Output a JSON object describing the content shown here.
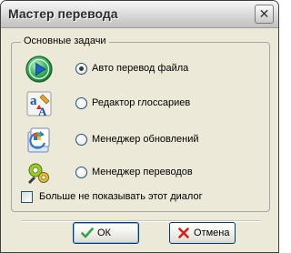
{
  "window": {
    "title": "Мастер перевода",
    "close_glyph": "✕"
  },
  "group": {
    "label": "Основные задачи",
    "options": [
      {
        "label": "Авто перевод файла",
        "icon": "play-circle-icon",
        "selected": true
      },
      {
        "label": "Редактор глоссариев",
        "icon": "glossary-editor-icon",
        "selected": false
      },
      {
        "label": "Менеджер обновлений",
        "icon": "update-manager-icon",
        "selected": false
      },
      {
        "label": "Менеджер переводов",
        "icon": "translation-manager-icon",
        "selected": false
      }
    ]
  },
  "dont_show": {
    "label": "Больше не показывать этот диалог",
    "checked": false
  },
  "buttons": {
    "ok": {
      "label": "ОК",
      "icon": "checkmark-icon"
    },
    "cancel": {
      "label": "Отмена",
      "icon": "cross-icon"
    }
  },
  "colors": {
    "dialog_bg": "#ece9d8",
    "accent_green": "#2ea44f",
    "cancel_red": "#d42020"
  }
}
